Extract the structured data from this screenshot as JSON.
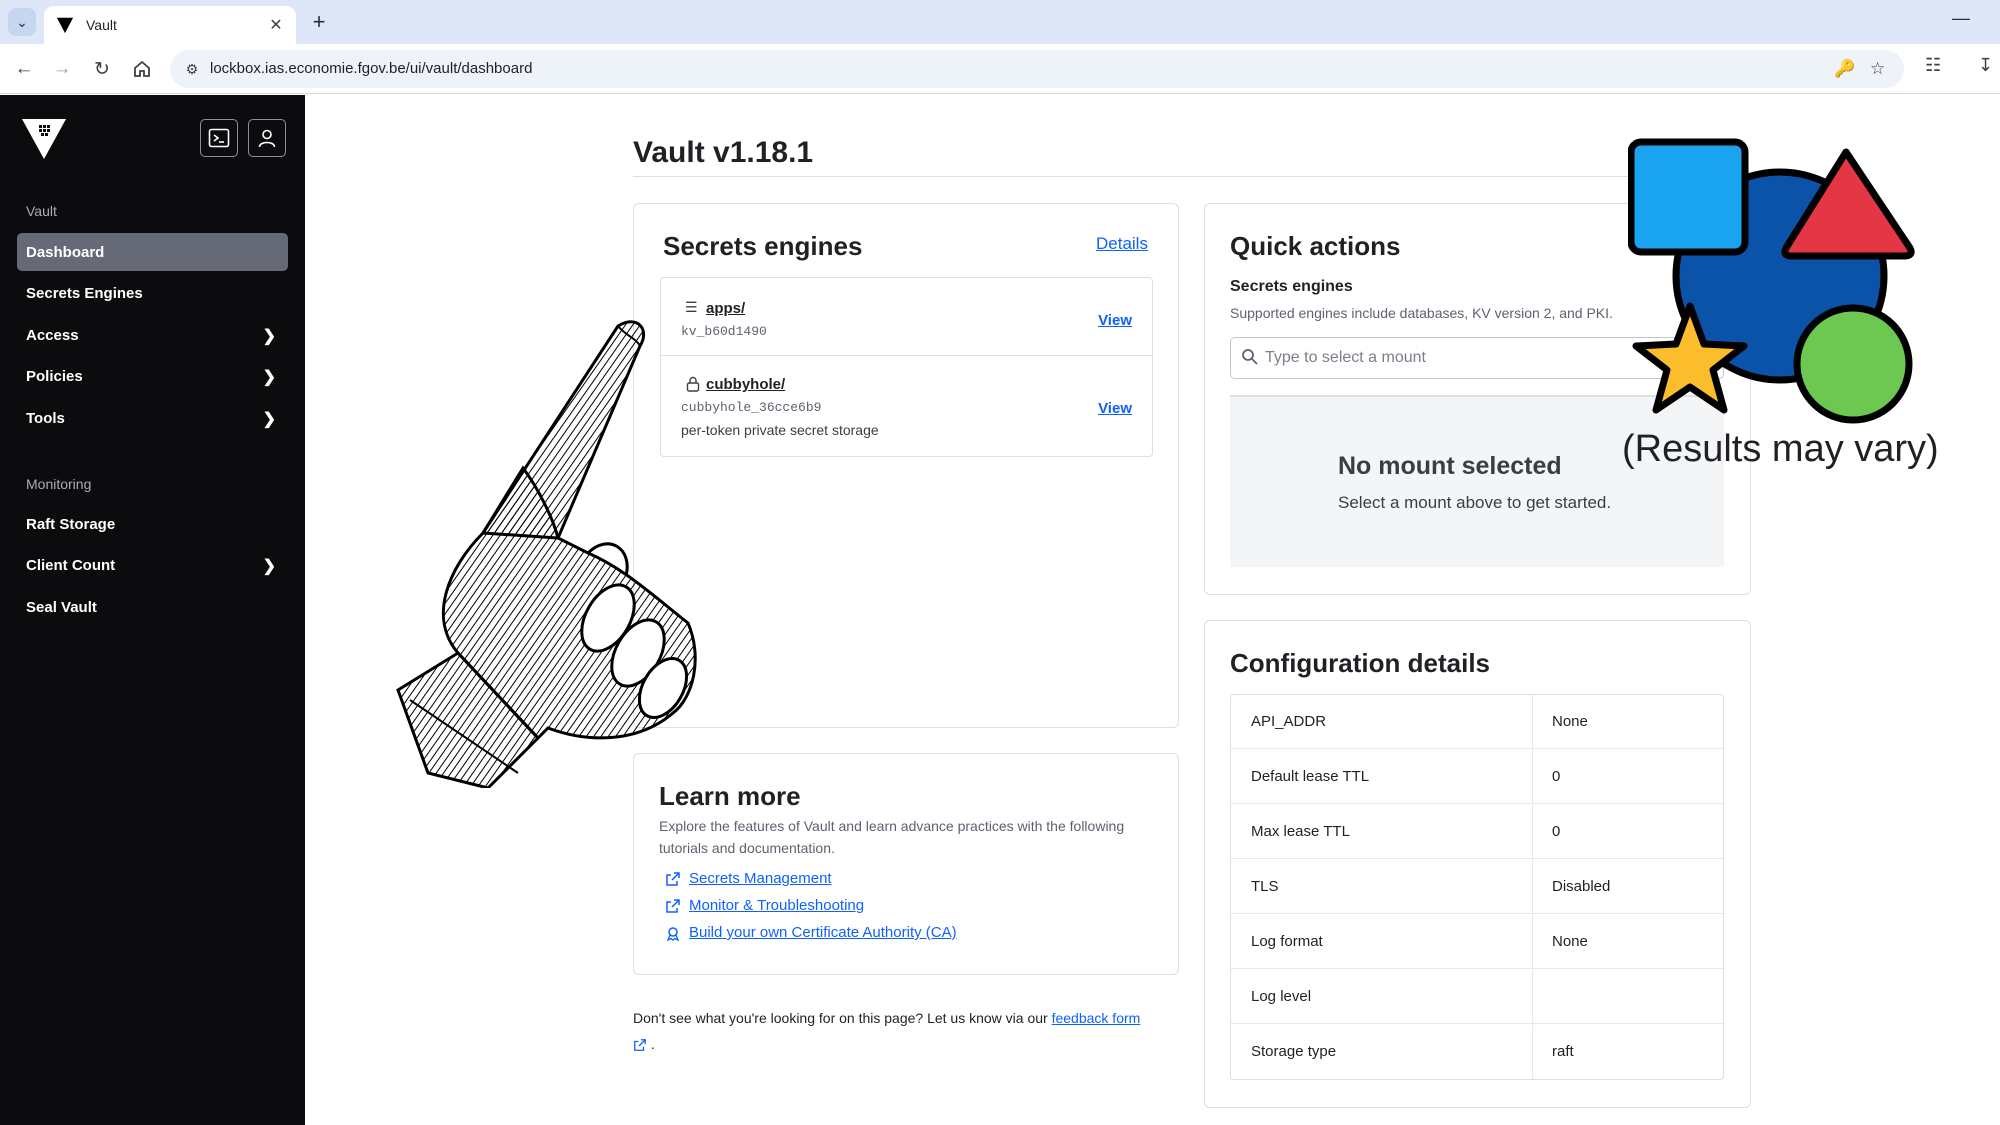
{
  "browser": {
    "tab_title": "Vault",
    "url": "lockbox.ias.economie.fgov.be/ui/vault/dashboard"
  },
  "sidebar": {
    "section_vault": "Vault",
    "section_monitoring": "Monitoring",
    "items": [
      {
        "label": "Dashboard"
      },
      {
        "label": "Secrets Engines"
      },
      {
        "label": "Access"
      },
      {
        "label": "Policies"
      },
      {
        "label": "Tools"
      },
      {
        "label": "Raft Storage"
      },
      {
        "label": "Client Count"
      },
      {
        "label": "Seal Vault"
      }
    ]
  },
  "page": {
    "title": "Vault v1.18.1"
  },
  "secrets_card": {
    "title": "Secrets engines",
    "details_label": "Details",
    "engines": [
      {
        "name": "apps/",
        "accessor": "kv_b60d1490",
        "description": "",
        "view_label": "View"
      },
      {
        "name": "cubbyhole/",
        "accessor": "cubbyhole_36cce6b9",
        "description": "per-token private secret storage",
        "view_label": "View"
      }
    ]
  },
  "quick_actions": {
    "title": "Quick actions",
    "subtitle": "Secrets engines",
    "help": "Supported engines include databases, KV version 2, and PKI.",
    "placeholder": "Type to select a mount",
    "empty_title": "No mount selected",
    "empty_body": "Select a mount above to get started."
  },
  "config": {
    "title": "Configuration details",
    "rows": [
      {
        "key": "API_ADDR",
        "value": "None"
      },
      {
        "key": "Default lease TTL",
        "value": "0"
      },
      {
        "key": "Max lease TTL",
        "value": "0"
      },
      {
        "key": "TLS",
        "value": "Disabled"
      },
      {
        "key": "Log format",
        "value": "None"
      },
      {
        "key": "Log level",
        "value": ""
      },
      {
        "key": "Storage type",
        "value": "raft"
      }
    ]
  },
  "learn_more": {
    "title": "Learn more",
    "body": "Explore the features of Vault and learn advance practices with the following tutorials and documentation.",
    "links": [
      {
        "label": "Secrets Management"
      },
      {
        "label": "Monitor & Troubleshooting"
      },
      {
        "label": "Build your own Certificate Authority (CA)"
      }
    ]
  },
  "footer": {
    "text": "Don't see what you're looking for on this page? Let us know via our",
    "link_label": "feedback form",
    "period": "."
  },
  "overlay": {
    "caption": "(Results may vary)"
  },
  "colors": {
    "sidebar_bg": "#0c0c0e",
    "sidebar_active": "#656a76",
    "link": "#1060ff",
    "shape_square": "#1aa4f0",
    "shape_circle": "#0a53a8",
    "shape_triangle": "#e53646",
    "shape_star": "#fbbd2c",
    "shape_green": "#6cc851"
  }
}
